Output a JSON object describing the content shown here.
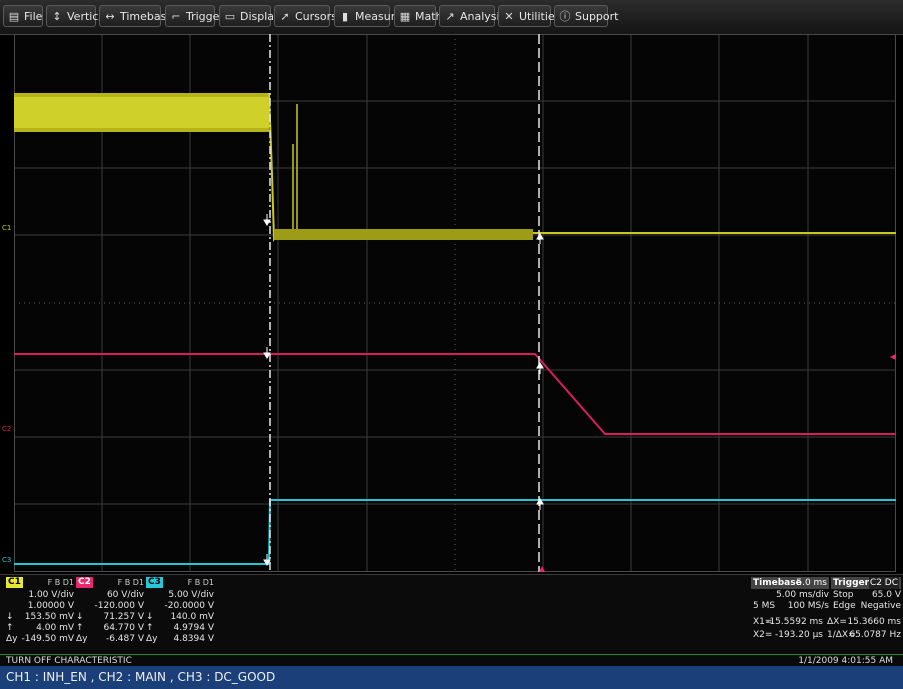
{
  "menu": [
    {
      "icon": "file-icon",
      "glyph": "▤",
      "label": "File"
    },
    {
      "icon": "vertical-icon",
      "glyph": "↕",
      "label": "Vertical"
    },
    {
      "icon": "timebase-icon",
      "glyph": "↔",
      "label": "Timebase"
    },
    {
      "icon": "trigger-icon",
      "glyph": "⌐",
      "label": "Trigger"
    },
    {
      "icon": "display-icon",
      "glyph": "▭",
      "label": "Display"
    },
    {
      "icon": "cursors-icon",
      "glyph": "➚",
      "label": "Cursors"
    },
    {
      "icon": "measure-icon",
      "glyph": "▮",
      "label": "Measure"
    },
    {
      "icon": "math-icon",
      "glyph": "▦",
      "label": "Math"
    },
    {
      "icon": "analysis-icon",
      "glyph": "↗",
      "label": "Analysis"
    },
    {
      "icon": "utilities-icon",
      "glyph": "✕",
      "label": "Utilities"
    },
    {
      "icon": "support-icon",
      "glyph": "ⓘ",
      "label": "Support"
    }
  ],
  "traces": {
    "c1": {
      "label": "C1",
      "color": "#c8c81e"
    },
    "c2": {
      "label": "C2",
      "color": "#d81e5a"
    },
    "c3": {
      "label": "C3",
      "color": "#22c8d8"
    }
  },
  "channels": {
    "c1": {
      "name": "C1",
      "color": "#e8e832",
      "fbd": "F B D1",
      "vdiv": "1.00 V/div",
      "offset": "1.00000 V",
      "down_val": "153.50 mV",
      "up_val": "4.00 mV",
      "dy_label": "Δy",
      "dy_val": "-149.50 mV"
    },
    "c2": {
      "name": "C2",
      "color": "#e8286a",
      "fbd": "F B D1",
      "vdiv": "60 V/div",
      "offset": "-120.000 V",
      "down_val": "71.257 V",
      "up_val": "64.770 V",
      "dy_label": "Δy",
      "dy_val": "-6.487 V"
    },
    "c3": {
      "name": "C3",
      "color": "#28c8d8",
      "fbd": "F B D1",
      "vdiv": "5.00 V/div",
      "offset": "-20.0000 V",
      "down_val": "140.0 mV",
      "up_val": "4.9794 V",
      "dy_label": "Δy",
      "dy_val": "4.8394 V"
    }
  },
  "timebase": {
    "title": "Timebase",
    "delay": "5.0 ms",
    "tdiv": "5.00 ms/div",
    "samples": "5 MS",
    "rate": "100 MS/s"
  },
  "trigger": {
    "title": "Trigger",
    "channel": "C2 DC",
    "mode": "Stop",
    "level": "65.0 V",
    "type": "Edge",
    "slope": "Negative"
  },
  "cursors": {
    "x1_label": "X1=",
    "x1": "-15.5592 ms",
    "dx_label": "ΔX=",
    "dx": "15.3660 ms",
    "x2_label": "X2=",
    "x2": "-193.20 µs",
    "inv_label": "1/ΔX=",
    "inv": "65.0787 Hz"
  },
  "status": {
    "title": "TURN OFF CHARACTERISTIC",
    "datetime": "1/1/2009 4:01:55 AM"
  },
  "description": "CH1 : INH_EN , CH2 : MAIN , CH3 : DC_GOOD"
}
